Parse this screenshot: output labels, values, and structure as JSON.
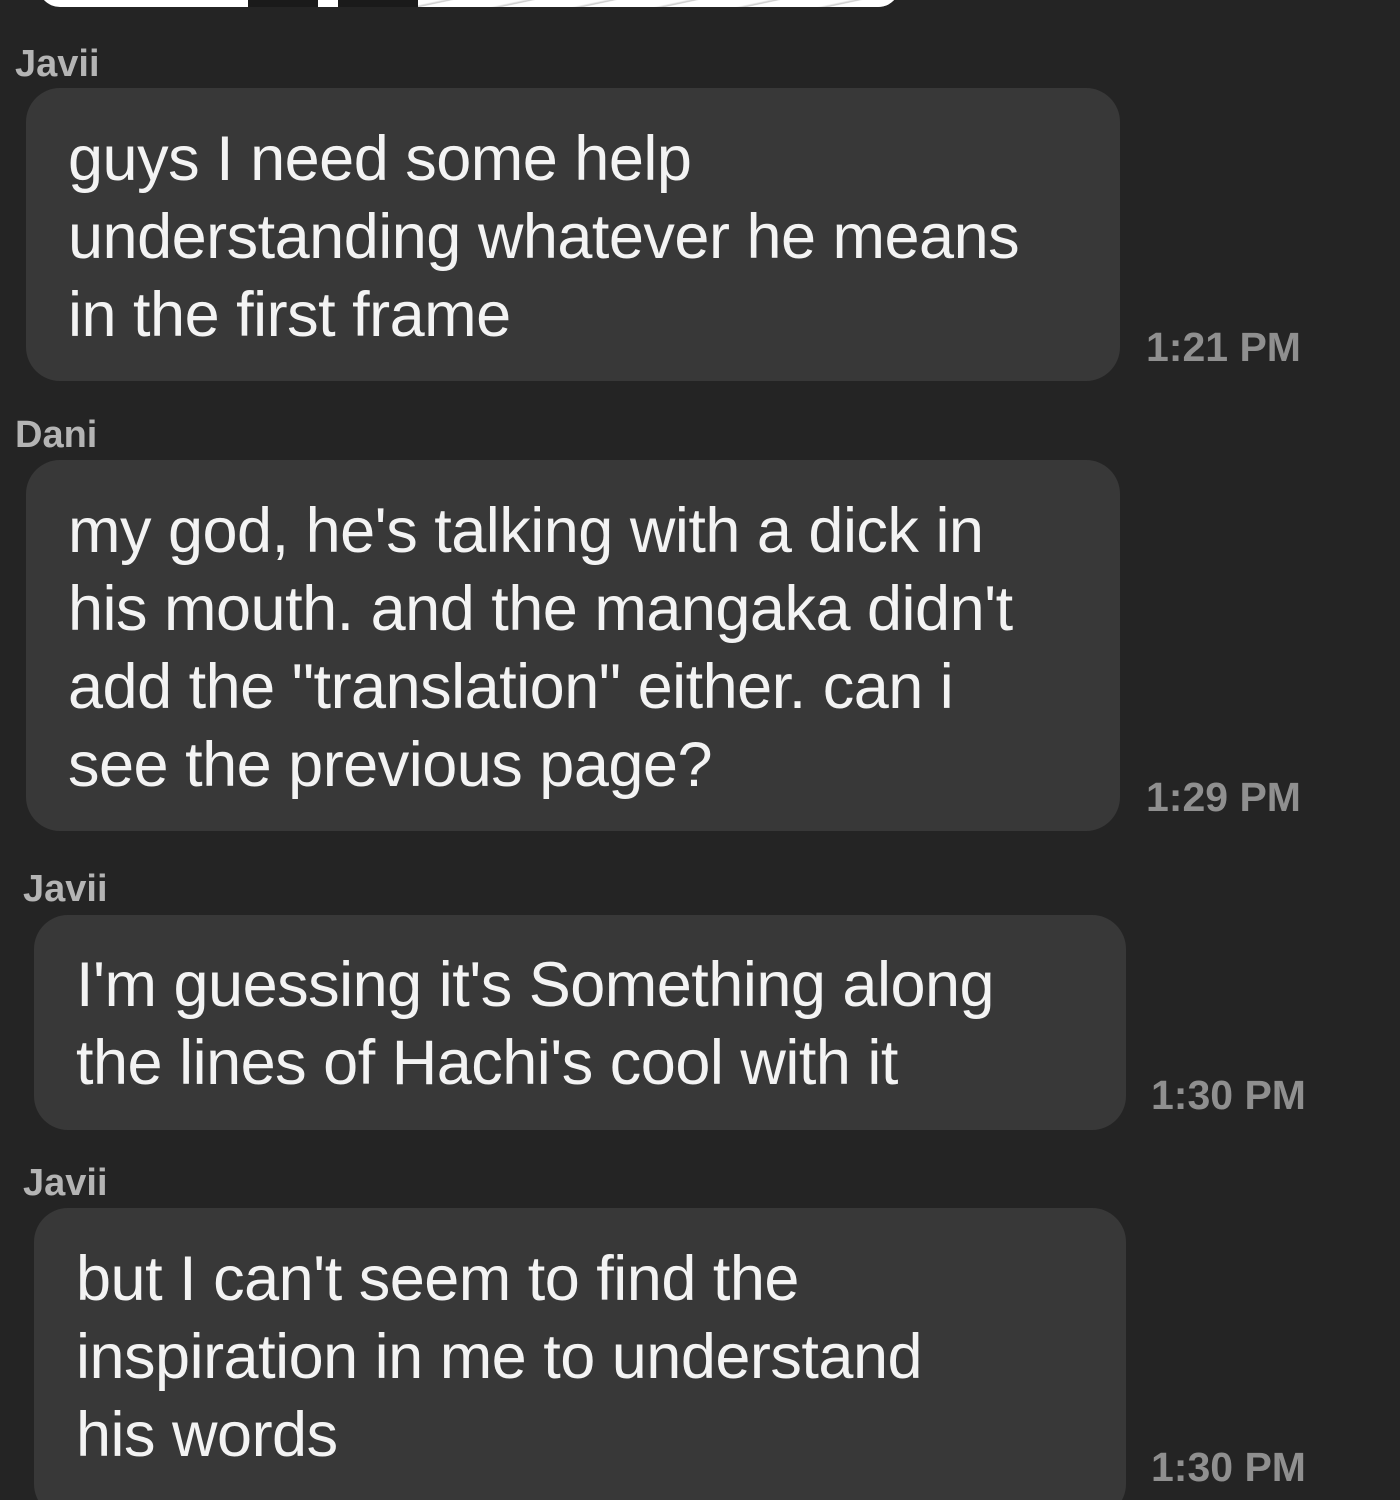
{
  "app": {
    "colors": {
      "background": "#242424",
      "bubble": "#383838",
      "message_text": "#f3f3f3",
      "sender_name": "#b4b4b4",
      "timestamp": "#8f8f8f"
    }
  },
  "messages": [
    {
      "sender": "Javii",
      "text": "guys I need some help\nunderstanding whatever he means\nin the first frame",
      "time": "1:21 PM"
    },
    {
      "sender": "Dani",
      "text": "my god, he's talking with a dick in\nhis mouth. and the mangaka didn't\nadd the \"translation\" either. can i\nsee the previous page?",
      "time": "1:29 PM"
    },
    {
      "sender": "Javii",
      "text": "I'm guessing it's Something along\nthe lines of Hachi's cool with it",
      "time": "1:30 PM"
    },
    {
      "sender": "Javii",
      "text": "but I can't seem to find the\ninspiration in me to understand\nhis words",
      "time": "1:30 PM"
    }
  ]
}
